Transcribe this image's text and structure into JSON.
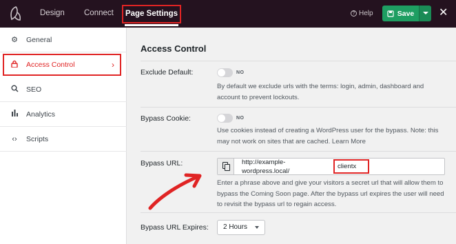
{
  "topbar": {
    "tabs": [
      "Design",
      "Connect",
      "Page Settings"
    ],
    "help_label": "Help",
    "save_label": "Save",
    "close_glyph": "✕"
  },
  "sidebar": {
    "items": [
      {
        "label": "General",
        "icon": "gear-icon"
      },
      {
        "label": "Access Control",
        "icon": "lock-icon",
        "active": true
      },
      {
        "label": "SEO",
        "icon": "search-icon"
      },
      {
        "label": "Analytics",
        "icon": "bar-chart-icon"
      },
      {
        "label": "Scripts",
        "icon": "code-icon"
      }
    ]
  },
  "main": {
    "title": "Access Control",
    "exclude_default": {
      "label": "Exclude Default:",
      "toggle_state": "NO",
      "description": "By default we exclude urls with the terms: login, admin, dashboard and account to prevent lockouts."
    },
    "bypass_cookie": {
      "label": "Bypass Cookie:",
      "toggle_state": "NO",
      "description": "Use cookies instead of creating a WordPress user for the bypass. Note: this may not work on sites that are cached. Learn More"
    },
    "bypass_url": {
      "label": "Bypass URL:",
      "prefix": "http://example-wordpress.local/",
      "value": "clientx",
      "description": "Enter a phrase above and give your visitors a secret url that will allow them to bypass the Coming Soon page. After the bypass url expires the user will need to revisit the bypass url to regain access."
    },
    "bypass_url_expires": {
      "label": "Bypass URL Expires:",
      "selected": "2 Hours"
    }
  },
  "colors": {
    "topbar": "#24121f",
    "save_green": "#1e9e62",
    "highlight_red": "#e02424"
  }
}
